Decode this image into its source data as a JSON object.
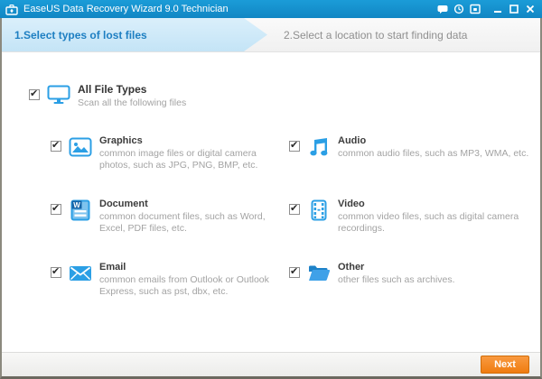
{
  "colors": {
    "titlebar": "#1591cd",
    "accent_blue": "#2b9fe5",
    "step_active_bg": "#cde8f7",
    "step_active_text": "#1e7fc2",
    "step_inactive_text": "#8f8f8f",
    "next_button_orange": "#f5831f"
  },
  "titlebar": {
    "title": "EaseUS Data Recovery Wizard 9.0 Technician",
    "icons": {
      "app": "toolbox",
      "chat": "chat-bubble",
      "history": "history-clock",
      "tray": "tray-window",
      "minimize": "minimize",
      "maximize": "maximize",
      "close": "close"
    }
  },
  "steps": {
    "step1": {
      "label": "1.Select types of lost files",
      "active": true
    },
    "step2": {
      "label": "2.Select a location to start finding data",
      "active": false
    }
  },
  "all_file_types": {
    "title": "All File Types",
    "subtitle": "Scan all the following files",
    "checked": true,
    "icon": "monitor"
  },
  "file_types": [
    {
      "title": "Graphics",
      "description": "common image files or digital camera photos, such as JPG, PNG, BMP, etc.",
      "checked": true,
      "icon": "picture"
    },
    {
      "title": "Audio",
      "description": "common audio files, such as MP3, WMA, etc.",
      "checked": true,
      "icon": "music-notes"
    },
    {
      "title": "Document",
      "description": "common document files, such as Word, Excel, PDF files, etc.",
      "checked": true,
      "icon": "word-document"
    },
    {
      "title": "Video",
      "description": "common video files, such as digital camera recordings.",
      "checked": true,
      "icon": "filmstrip"
    },
    {
      "title": "Email",
      "description": "common emails from Outlook or Outlook Express, such as pst, dbx, etc.",
      "checked": true,
      "icon": "envelope"
    },
    {
      "title": "Other",
      "description": "other files such as archives.",
      "checked": true,
      "icon": "folder"
    }
  ],
  "footer": {
    "next_label": "Next"
  }
}
